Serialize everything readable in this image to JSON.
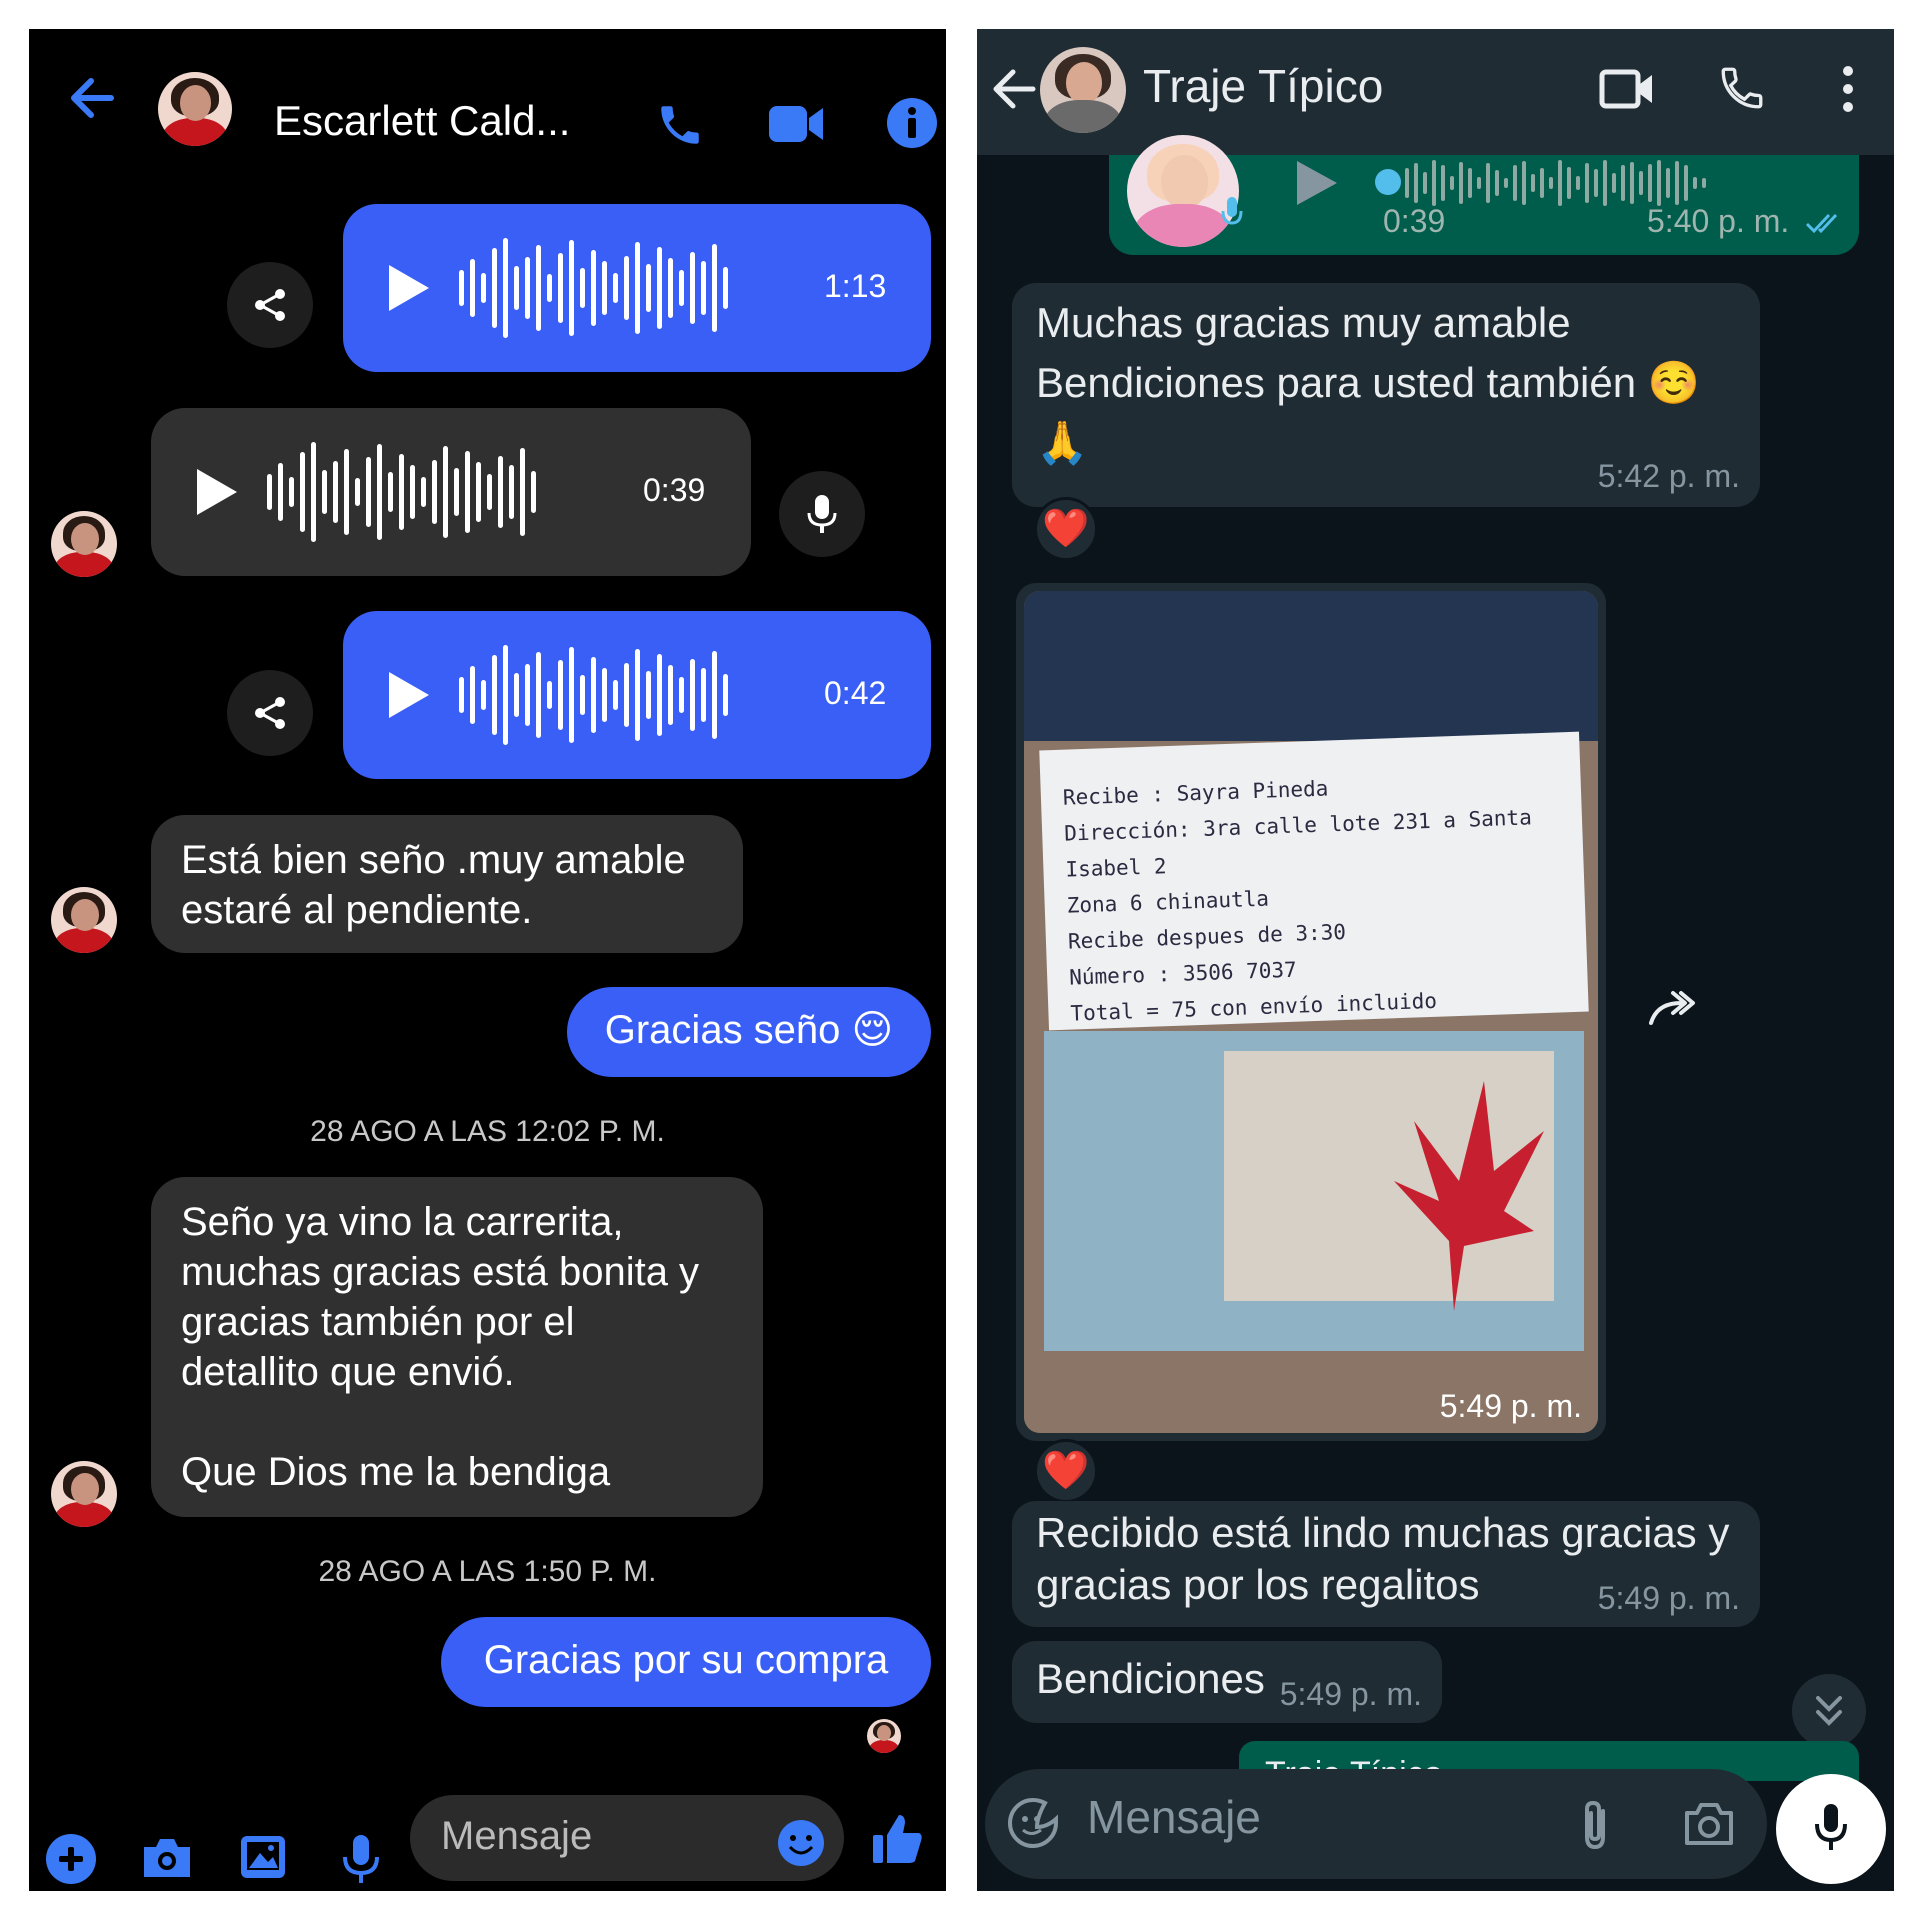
{
  "messenger": {
    "header": {
      "contact_name": "Escarlett Cald..."
    },
    "messages": [
      {
        "type": "audio",
        "direction": "out",
        "duration": "1:13"
      },
      {
        "type": "audio",
        "direction": "in",
        "duration": "0:39"
      },
      {
        "type": "audio",
        "direction": "out",
        "duration": "0:42"
      },
      {
        "type": "text",
        "direction": "in",
        "lines": [
          "Está bien seño .muy amable",
          "estaré al pendiente."
        ]
      },
      {
        "type": "text",
        "direction": "out",
        "text": "Gracias seño 😌"
      },
      {
        "type": "timestamp",
        "text": "28 AGO A LAS 12:02 P. M."
      },
      {
        "type": "text",
        "direction": "in",
        "lines": [
          "Seño ya vino la carrerita,",
          "muchas gracias está bonita y",
          "gracias también por el",
          "detallito que envió.",
          "",
          "Que Dios me la bendiga"
        ]
      },
      {
        "type": "timestamp",
        "text": "28 AGO A LAS 1:50 P. M."
      },
      {
        "type": "text",
        "direction": "out",
        "text": "Gracias por su compra"
      }
    ],
    "composer": {
      "placeholder": "Mensaje"
    },
    "colors": {
      "accent": "#3a5ff6",
      "incoming_bubble": "#303030",
      "background": "#000000"
    }
  },
  "whatsapp": {
    "header": {
      "chat_name": "Traje Típico"
    },
    "voice_note": {
      "duration": "0:39",
      "time": "5:40 p. m."
    },
    "messages": [
      {
        "lines": [
          "Muchas gracias muy amable",
          "Bendiciones para usted también ☺️",
          "🙏"
        ],
        "time": "5:42 p. m.",
        "reaction": "❤️"
      },
      {
        "type": "image",
        "time": "5:49 p. m.",
        "reaction": "❤️",
        "note_lines": [
          "Recibe : Sayra Pineda",
          "Dirección: 3ra calle lote 231 a Santa Isabel 2",
          "Zona 6 chinautla",
          "Recibe despues de 3:30",
          "Número : 3506 7037",
          "Total = 75 con envío incluido"
        ]
      },
      {
        "lines": [
          "Recibido está lindo muchas gracias y",
          "gracias por los regalitos"
        ],
        "time": "5:49 p. m."
      },
      {
        "lines": [
          "Bendiciones"
        ],
        "time": "5:49 p. m."
      }
    ],
    "quoted_preview": "Traje Típico",
    "composer": {
      "placeholder": "Mensaje"
    },
    "colors": {
      "header": "#202c33",
      "incoming_bubble": "#202c33",
      "outgoing_bubble": "#005c4b",
      "background": "#0b141a"
    }
  }
}
